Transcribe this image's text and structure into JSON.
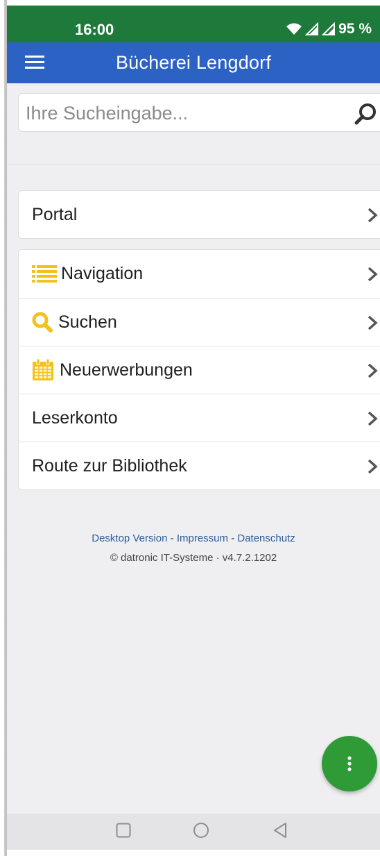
{
  "status_bar": {
    "time": "16:00",
    "battery": "95 %"
  },
  "app_bar": {
    "title": "Bücherei Lengdorf",
    "menu_icon": "hamburger-menu-icon"
  },
  "search": {
    "placeholder": "Ihre Sucheingabe...",
    "value": "",
    "icon": "search-icon"
  },
  "portal": {
    "label": "Portal"
  },
  "menu": {
    "items": [
      {
        "label": "Navigation",
        "icon": "list-icon"
      },
      {
        "label": "Suchen",
        "icon": "magnifier-icon"
      },
      {
        "label": "Neuerwerbungen",
        "icon": "calendar-icon"
      },
      {
        "label": "Leserkonto",
        "icon": ""
      },
      {
        "label": "Route zur Bibliothek",
        "icon": ""
      }
    ]
  },
  "footer": {
    "desktop": "Desktop Version",
    "impressum": "Impressum",
    "datenschutz": "Datenschutz",
    "separator": "-",
    "copyright": "© datronic IT-Systeme · v4.7.2.1202"
  },
  "colors": {
    "status_bar": "#1e7a3a",
    "app_bar": "#2b62c4",
    "fab": "#2e9b36",
    "icon_yellow": "#f2c21b",
    "link": "#2a5d9c"
  }
}
